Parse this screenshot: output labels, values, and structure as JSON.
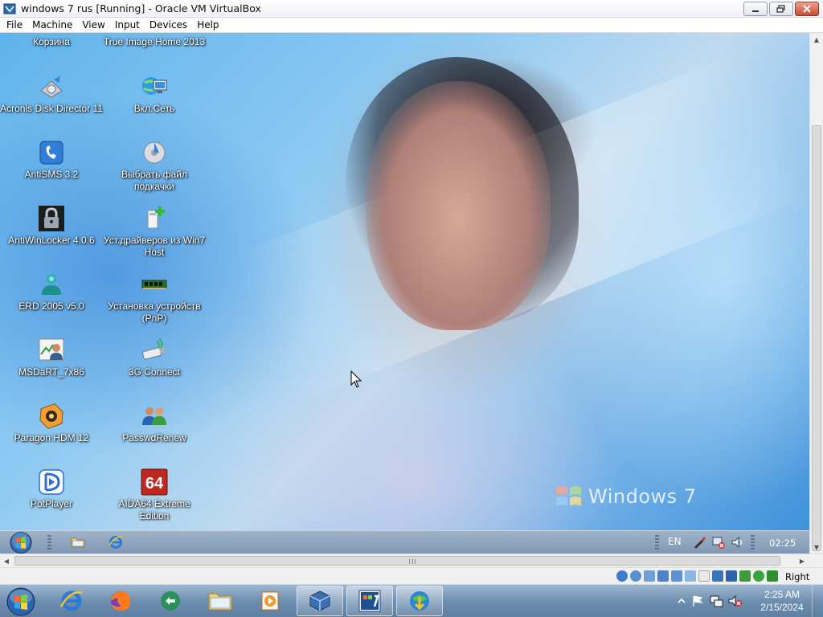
{
  "window": {
    "title": "windows 7 rus [Running] - Oracle VM VirtualBox"
  },
  "menu": {
    "items": [
      "File",
      "Machine",
      "View",
      "Input",
      "Devices",
      "Help"
    ]
  },
  "desktop": {
    "icons": [
      {
        "label": "Корзина",
        "icon": "recycle-bin-icon"
      },
      {
        "label": "True Image Home 2013",
        "icon": "true-image-icon"
      },
      {
        "label": "Acronis Disk Director 11",
        "icon": "acronis-disk-director-icon"
      },
      {
        "label": "Вкл.Сеть",
        "icon": "network-icon"
      },
      {
        "label": "AntiSMS 3.2",
        "icon": "antisms-icon"
      },
      {
        "label": "Выбрать файл подкачки",
        "icon": "pagefile-icon"
      },
      {
        "label": "AntiWinLocker 4.0.6",
        "icon": "padlock-icon"
      },
      {
        "label": "Уст.драйверов из Win7 Host",
        "icon": "driver-install-icon"
      },
      {
        "label": "ERD 2005 v5.0",
        "icon": "erd-commander-icon"
      },
      {
        "label": "Установка устройств (PnP)",
        "icon": "memory-module-icon"
      },
      {
        "label": "MSDaRT_7x86",
        "icon": "msdart-icon"
      },
      {
        "label": "3G Connect",
        "icon": "usb-modem-icon"
      },
      {
        "label": "Paragon HDM 12",
        "icon": "paragon-icon"
      },
      {
        "label": "PasswdRenew",
        "icon": "users-icon"
      },
      {
        "label": "PotPlayer",
        "icon": "potplayer-icon"
      },
      {
        "label": "AIDA64 Extreme Edition",
        "icon": "aida64-icon"
      }
    ],
    "aida_badge": "64",
    "wallpaper_brand": "Windows 7"
  },
  "guest_taskbar": {
    "language": "EN",
    "clock": "02:25"
  },
  "statusbar": {
    "host_key": "Right Ctrl"
  },
  "host_taskbar": {
    "time": "2:25 AM",
    "date": "2/15/2024"
  },
  "colors": {
    "taskbar_blue": "#6f8fb0",
    "desktop_sky": "#8fcaf2"
  }
}
